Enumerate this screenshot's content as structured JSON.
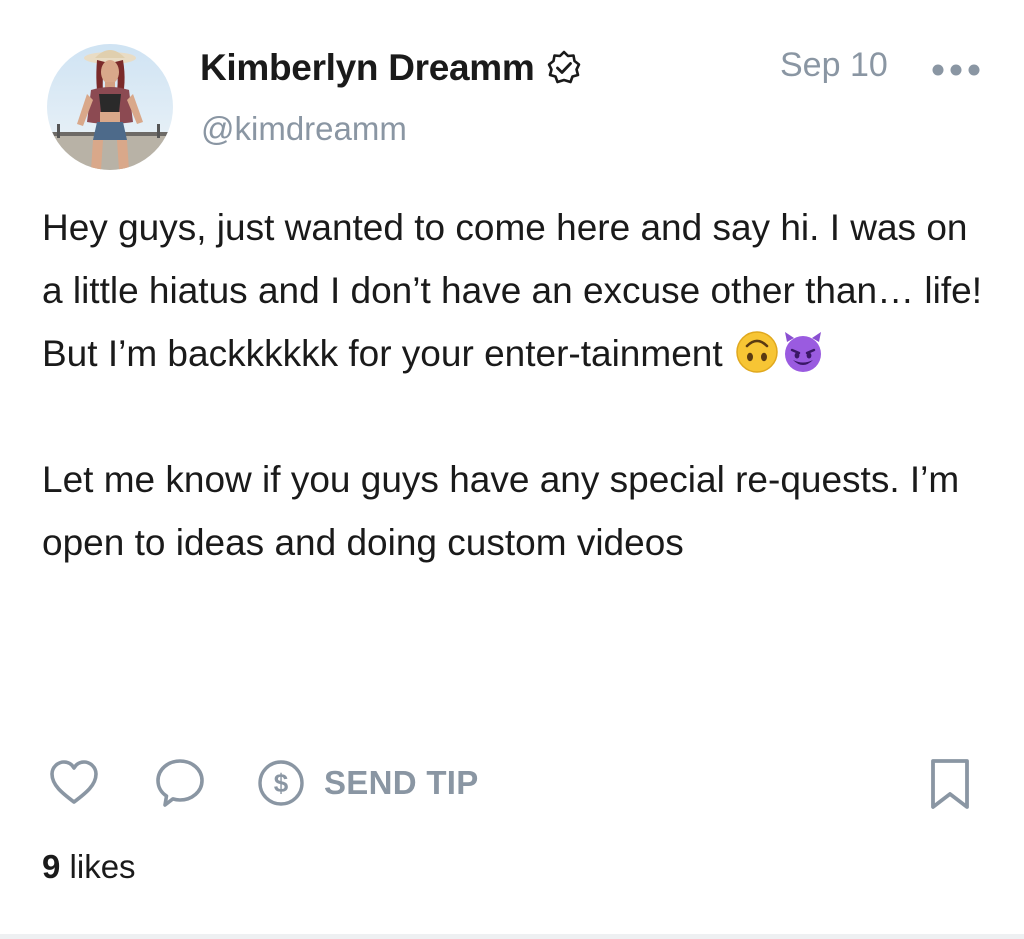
{
  "author": {
    "display_name": "Kimberlyn Dreamm",
    "handle": "@kimdreamm",
    "verified": true,
    "avatar": "avatar-photo"
  },
  "post": {
    "date": "Sep 10",
    "paragraphs": [
      "Hey guys, just wanted to come here and say hi. I was on a little hiatus and I don’t have an excuse other than… life! But I’m backkkkkk for your enter-tainment",
      "Let me know if you guys have any special re-quests. I’m open to ideas and doing custom videos"
    ],
    "emojis": [
      "upside-down-face-emoji",
      "smiling-devil-emoji"
    ]
  },
  "actions": {
    "like_icon": "heart-icon",
    "comment_icon": "comment-bubble-icon",
    "tip_icon": "dollar-circle-icon",
    "tip_label": "SEND TIP",
    "bookmark_icon": "bookmark-icon",
    "more_icon": "more-dots-icon"
  },
  "likes": {
    "count": "9",
    "label": "likes"
  },
  "colors": {
    "text": "#1a1a1a",
    "muted": "#8a96a3",
    "icon": "#8a96a3"
  }
}
